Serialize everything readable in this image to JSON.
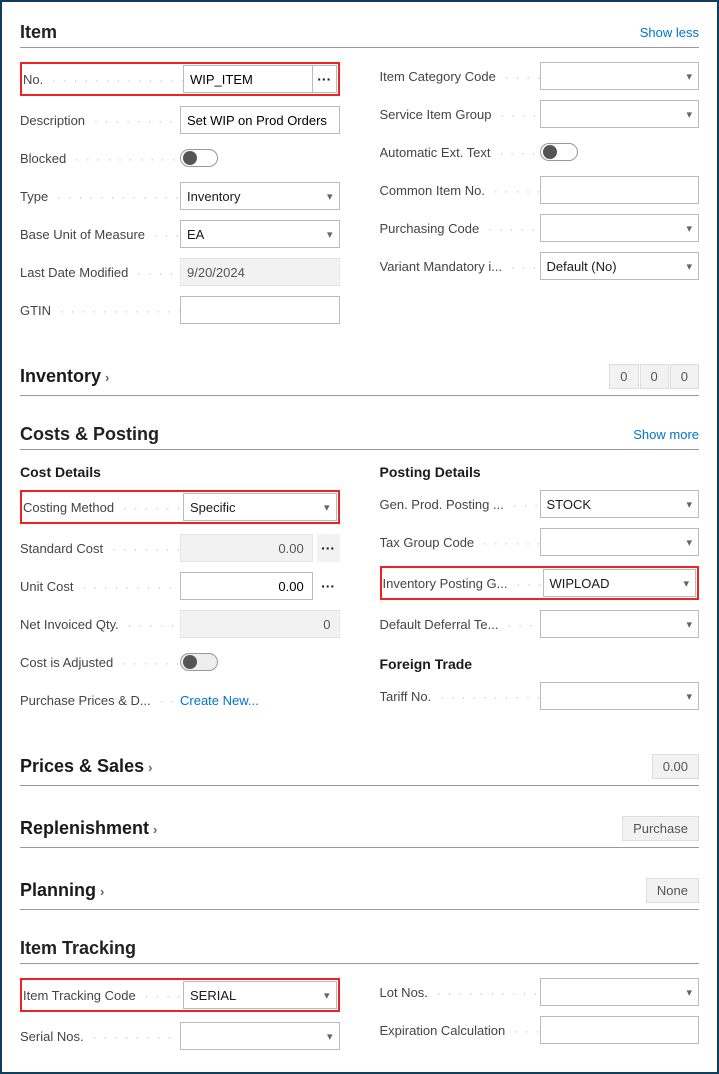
{
  "item": {
    "title": "Item",
    "show_less": "Show less",
    "left": {
      "no_label": "No.",
      "no_value": "WIP_ITEM",
      "desc_label": "Description",
      "desc_value": "Set WIP on Prod Orders",
      "blocked_label": "Blocked",
      "type_label": "Type",
      "type_value": "Inventory",
      "base_uom_label": "Base Unit of Measure",
      "base_uom_value": "EA",
      "last_mod_label": "Last Date Modified",
      "last_mod_value": "9/20/2024",
      "gtin_label": "GTIN",
      "gtin_value": ""
    },
    "right": {
      "cat_label": "Item Category Code",
      "cat_value": "",
      "svc_label": "Service Item Group",
      "svc_value": "",
      "autoext_label": "Automatic Ext. Text",
      "common_label": "Common Item No.",
      "common_value": "",
      "purch_label": "Purchasing Code",
      "purch_value": "",
      "variant_label": "Variant Mandatory i...",
      "variant_value": "Default (No)"
    }
  },
  "inventory": {
    "title": "Inventory",
    "cells": [
      "0",
      "0",
      "0"
    ]
  },
  "costs": {
    "title": "Costs & Posting",
    "show_more": "Show more",
    "cost_details_title": "Cost Details",
    "posting_details_title": "Posting Details",
    "left": {
      "costing_method_label": "Costing Method",
      "costing_method_value": "Specific",
      "std_cost_label": "Standard Cost",
      "std_cost_value": "0.00",
      "unit_cost_label": "Unit Cost",
      "unit_cost_value": "0.00",
      "net_inv_label": "Net Invoiced Qty.",
      "net_inv_value": "0",
      "cost_adj_label": "Cost is Adjusted",
      "purch_prices_label": "Purchase Prices & D...",
      "purch_prices_link": "Create New..."
    },
    "right": {
      "gen_prod_label": "Gen. Prod. Posting ...",
      "gen_prod_value": "STOCK",
      "tax_group_label": "Tax Group Code",
      "tax_group_value": "",
      "inv_post_label": "Inventory Posting G...",
      "inv_post_value": "WIPLOAD",
      "deferral_label": "Default Deferral Te...",
      "deferral_value": "",
      "foreign_trade_title": "Foreign Trade",
      "tariff_label": "Tariff No.",
      "tariff_value": ""
    }
  },
  "prices_sales": {
    "title": "Prices & Sales",
    "badge": "0.00"
  },
  "replenishment": {
    "title": "Replenishment",
    "badge": "Purchase"
  },
  "planning": {
    "title": "Planning",
    "badge": "None"
  },
  "item_tracking": {
    "title": "Item Tracking",
    "left": {
      "it_code_label": "Item Tracking Code",
      "it_code_value": "SERIAL",
      "serial_label": "Serial Nos.",
      "serial_value": ""
    },
    "right": {
      "lot_label": "Lot Nos.",
      "lot_value": "",
      "exp_label": "Expiration Calculation",
      "exp_value": ""
    }
  }
}
